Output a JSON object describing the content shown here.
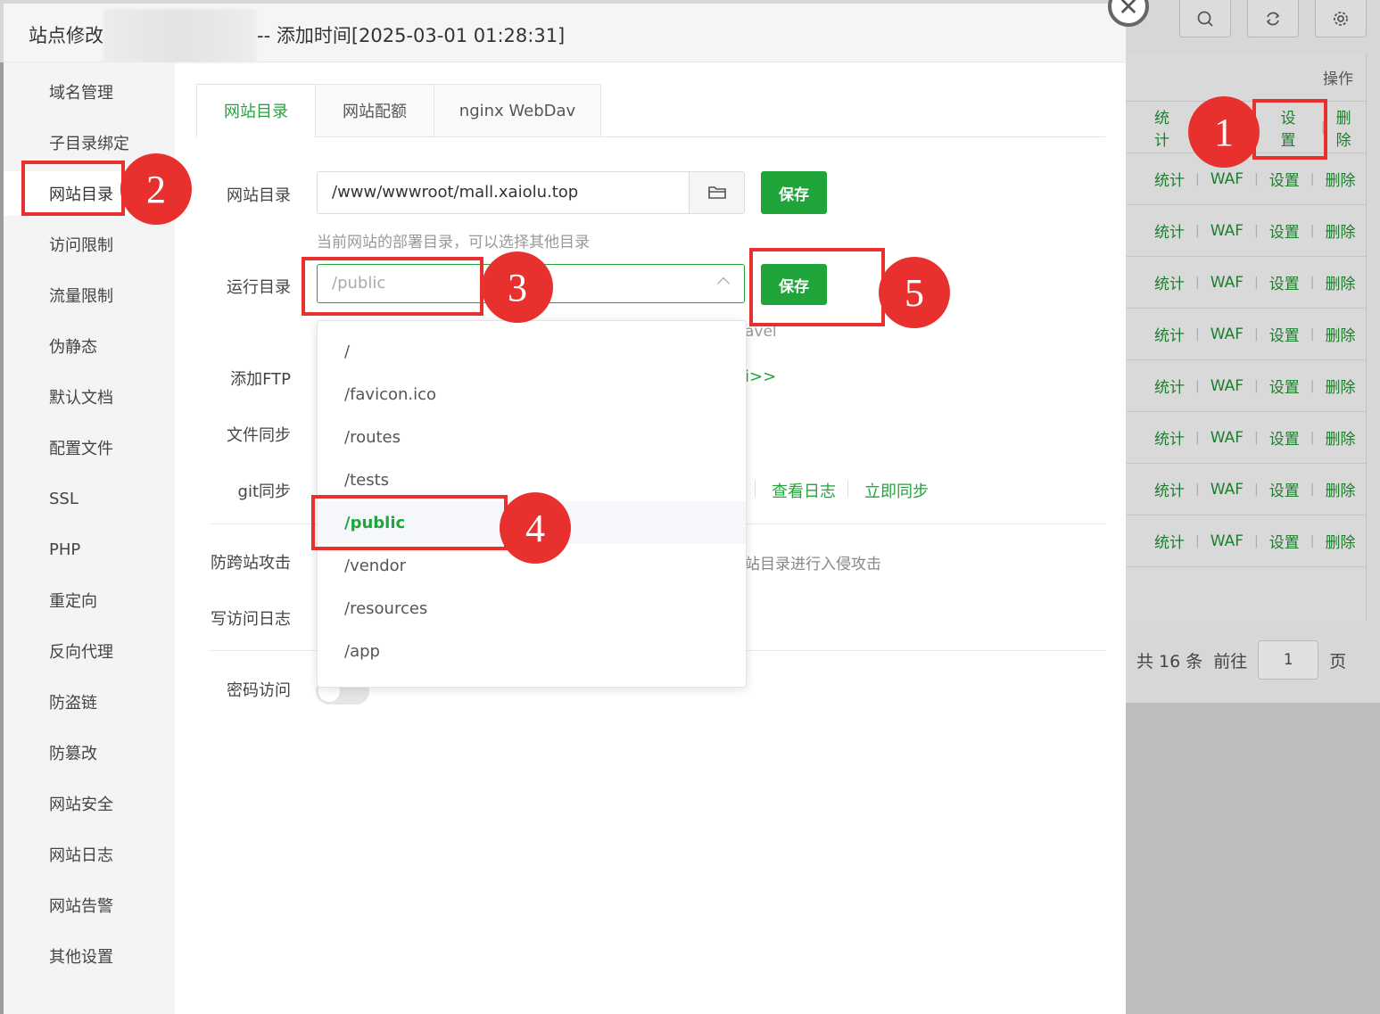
{
  "background": {
    "header": "操作",
    "row_ops_first": [
      "统计",
      "设置",
      "删除"
    ],
    "row_ops": [
      "统计",
      "WAF",
      "设置",
      "删除"
    ],
    "row_count": 9,
    "pager": {
      "total": "共 16 条",
      "goto": "前往",
      "page": "1",
      "page_suffix": "页"
    },
    "toolbar_icons": [
      "search-icon",
      "refresh-icon",
      "gear-icon"
    ]
  },
  "dialog": {
    "title_prefix": "站点修改",
    "title_suffix": "-- 添加时间[2025-03-01 01:28:31]",
    "close_glyph": "✕"
  },
  "sidebar": {
    "active_index": 2,
    "items": [
      "域名管理",
      "子目录绑定",
      "网站目录",
      "访问限制",
      "流量限制",
      "伪静态",
      "默认文档",
      "配置文件",
      "SSL",
      "PHP",
      "重定向",
      "反向代理",
      "防盗链",
      "防篡改",
      "网站安全",
      "网站日志",
      "网站告警",
      "其他设置"
    ]
  },
  "tabs": [
    "网站目录",
    "网站配额",
    "nginx WebDav"
  ],
  "form": {
    "site_dir_label": "网站目录",
    "site_dir_value": "/www/wwwroot/mall.xaiolu.top",
    "save_label": "保存",
    "site_dir_hint": "当前网站的部署目录，可以选择其他目录",
    "run_dir_label": "运行目录",
    "run_dir_placeholder": "/public",
    "run_dir_hint_partial": "avel",
    "ftp_label": "添加FTP",
    "ftp_link_partial": "i>>",
    "sync_label": "文件同步",
    "git_label": "git同步",
    "git_view_log": "查看日志",
    "git_sync_now": "立即同步",
    "anti_cross_label": "防跨站攻击",
    "anti_cross_hint_partial": "站目录进行入侵攻击",
    "access_log_label": "写访问日志",
    "password_label": "密码访问"
  },
  "dropdown": {
    "selected_index": 4,
    "options": [
      "/",
      "/favicon.ico",
      "/routes",
      "/tests",
      "/public",
      "/vendor",
      "/resources",
      "/app"
    ]
  },
  "annotations": [
    "1",
    "2",
    "3",
    "4",
    "5"
  ],
  "colors": {
    "accent": "#20a53a",
    "annotation": "#e8312f"
  }
}
